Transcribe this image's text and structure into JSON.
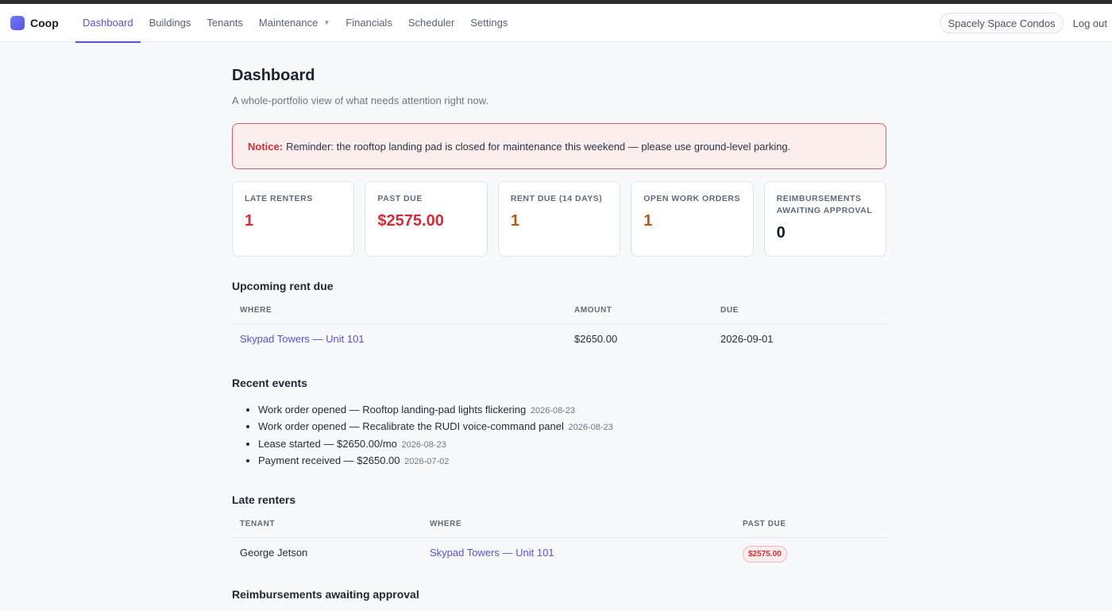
{
  "nav": {
    "brand": "Coop",
    "links": [
      {
        "label": "Dashboard",
        "active": true
      },
      {
        "label": "Buildings"
      },
      {
        "label": "Tenants"
      },
      {
        "label": "Maintenance",
        "dropdown": true
      },
      {
        "label": "Financials"
      },
      {
        "label": "Scheduler"
      },
      {
        "label": "Settings"
      }
    ],
    "org": "Spacely Space Condos",
    "logout": "Log out"
  },
  "page": {
    "title": "Dashboard",
    "subtitle": "A whole-portfolio view of what needs attention right now."
  },
  "notice": {
    "label": "Notice:",
    "text": "Reminder: the rooftop landing pad is closed for maintenance this weekend — please use ground-level parking."
  },
  "stats": [
    {
      "label": "LATE RENTERS",
      "value": "1",
      "color": "#d42c36"
    },
    {
      "label": "PAST DUE",
      "value": "$2575.00",
      "color": "#d42c36"
    },
    {
      "label": "RENT DUE (14 DAYS)",
      "value": "1",
      "color": "#b45a14"
    },
    {
      "label": "OPEN WORK ORDERS",
      "value": "1",
      "color": "#b45a14"
    },
    {
      "label": "REIMBURSEMENTS AWAITING APPROVAL",
      "value": "0",
      "color": "#111a26"
    }
  ],
  "upcoming_rent": {
    "title": "Upcoming rent due",
    "columns": [
      "WHERE",
      "AMOUNT",
      "DUE"
    ],
    "rows": [
      {
        "where": "Skypad Towers — Unit 101",
        "amount": "$2650.00",
        "due": "2026-09-01"
      }
    ]
  },
  "recent_events": {
    "title": "Recent events",
    "items": [
      {
        "text": "Work order opened — Rooftop landing-pad lights flickering",
        "date": "2026-08-23"
      },
      {
        "text": "Work order opened — Recalibrate the RUDI voice-command panel",
        "date": "2026-08-23"
      },
      {
        "text": "Lease started — $2650.00/mo",
        "date": "2026-08-23"
      },
      {
        "text": "Payment received — $2650.00",
        "date": "2026-07-02"
      }
    ]
  },
  "late_renters": {
    "title": "Late renters",
    "columns": [
      "TENANT",
      "WHERE",
      "PAST DUE"
    ],
    "rows": [
      {
        "tenant": "George Jetson",
        "where": "Skypad Towers — Unit 101",
        "past_due": "$2575.00"
      }
    ]
  },
  "reimbursements": {
    "title": "Reimbursements awaiting approval"
  }
}
